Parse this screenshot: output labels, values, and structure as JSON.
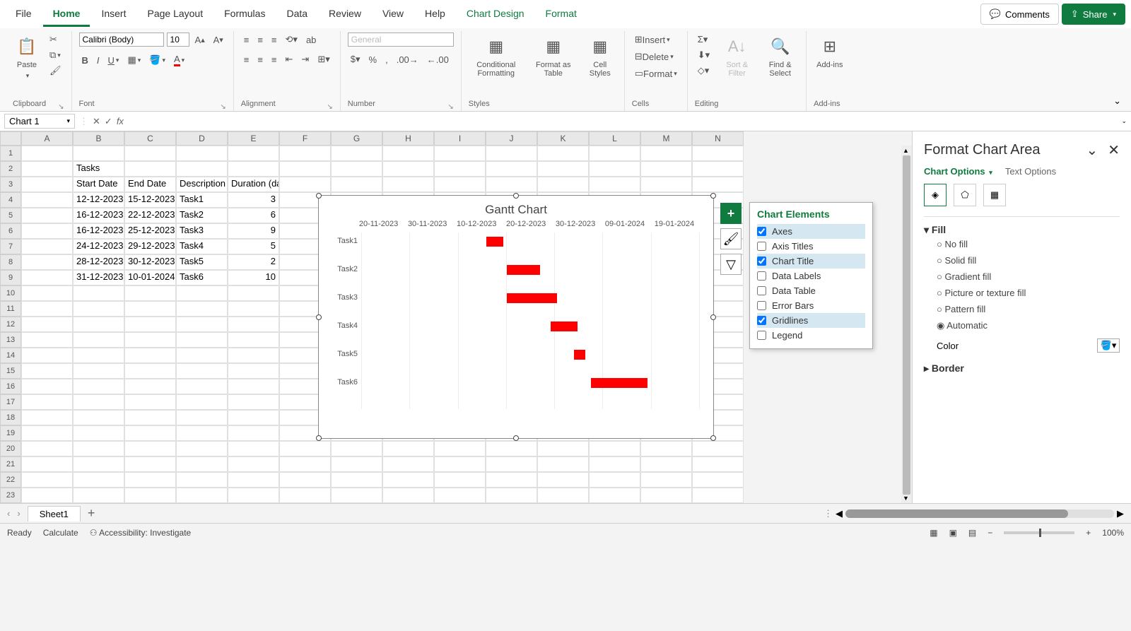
{
  "menu": {
    "file": "File",
    "home": "Home",
    "insert": "Insert",
    "pagelayout": "Page Layout",
    "formulas": "Formulas",
    "data": "Data",
    "review": "Review",
    "view": "View",
    "help": "Help",
    "chartdesign": "Chart Design",
    "format": "Format"
  },
  "toprow": {
    "comments": "Comments",
    "share": "Share"
  },
  "ribbon": {
    "clipboard": {
      "paste": "Paste",
      "label": "Clipboard"
    },
    "font": {
      "name": "Calibri (Body)",
      "size": "10",
      "label": "Font"
    },
    "alignment": {
      "label": "Alignment"
    },
    "number": {
      "format": "General",
      "label": "Number"
    },
    "styles": {
      "cond": "Conditional Formatting",
      "table": "Format as Table",
      "cell": "Cell Styles",
      "label": "Styles"
    },
    "cells": {
      "insert": "Insert",
      "delete": "Delete",
      "format": "Format",
      "label": "Cells"
    },
    "editing": {
      "sort": "Sort & Filter",
      "find": "Find & Select",
      "label": "Editing"
    },
    "addins": {
      "addins": "Add-ins",
      "label": "Add-ins"
    }
  },
  "formula": {
    "name": "Chart 1",
    "value": ""
  },
  "cols": [
    "A",
    "B",
    "C",
    "D",
    "E",
    "F",
    "G",
    "H",
    "I",
    "J",
    "K",
    "L",
    "M",
    "N"
  ],
  "rows_count": 23,
  "table": {
    "b2": "Tasks",
    "headers": {
      "b": "Start Date",
      "c": "End Date",
      "d": "Description",
      "e": "Duration (days)"
    },
    "rows": [
      {
        "start": "12-12-2023",
        "end": "15-12-2023",
        "desc": "Task1",
        "dur": "3"
      },
      {
        "start": "16-12-2023",
        "end": "22-12-2023",
        "desc": "Task2",
        "dur": "6"
      },
      {
        "start": "16-12-2023",
        "end": "25-12-2023",
        "desc": "Task3",
        "dur": "9"
      },
      {
        "start": "24-12-2023",
        "end": "29-12-2023",
        "desc": "Task4",
        "dur": "5"
      },
      {
        "start": "28-12-2023",
        "end": "30-12-2023",
        "desc": "Task5",
        "dur": "2"
      },
      {
        "start": "31-12-2023",
        "end": "10-01-2024",
        "desc": "Task6",
        "dur": "10"
      }
    ]
  },
  "chart": {
    "title": "Gantt Chart",
    "dates": [
      "20-11-2023",
      "30-11-2023",
      "10-12-2023",
      "20-12-2023",
      "30-12-2023",
      "09-01-2024",
      "19-01-2024"
    ],
    "tasks": [
      "Task1",
      "Task2",
      "Task3",
      "Task4",
      "Task5",
      "Task6"
    ]
  },
  "chart_data": {
    "type": "bar",
    "title": "Gantt Chart",
    "orientation": "horizontal",
    "x_axis": {
      "type": "date",
      "ticks": [
        "20-11-2023",
        "30-11-2023",
        "10-12-2023",
        "20-12-2023",
        "30-12-2023",
        "09-01-2024",
        "19-01-2024"
      ],
      "range": [
        "20-11-2023",
        "19-01-2024"
      ]
    },
    "categories": [
      "Task1",
      "Task2",
      "Task3",
      "Task4",
      "Task5",
      "Task6"
    ],
    "series": [
      {
        "name": "Start Date",
        "role": "offset",
        "values": [
          "12-12-2023",
          "16-12-2023",
          "16-12-2023",
          "24-12-2023",
          "28-12-2023",
          "31-12-2023"
        ],
        "fill": "none"
      },
      {
        "name": "Duration (days)",
        "role": "length",
        "values": [
          3,
          6,
          9,
          5,
          2,
          10
        ],
        "color": "#ff0000"
      }
    ],
    "gridlines": {
      "vertical": true,
      "horizontal": false
    },
    "legend": false
  },
  "elements": {
    "title": "Chart Elements",
    "items": [
      {
        "label": "Axes",
        "checked": true
      },
      {
        "label": "Axis Titles",
        "checked": false
      },
      {
        "label": "Chart Title",
        "checked": true
      },
      {
        "label": "Data Labels",
        "checked": false
      },
      {
        "label": "Data Table",
        "checked": false
      },
      {
        "label": "Error Bars",
        "checked": false
      },
      {
        "label": "Gridlines",
        "checked": true
      },
      {
        "label": "Legend",
        "checked": false
      }
    ]
  },
  "pane": {
    "title": "Format Chart Area",
    "tab1": "Chart Options",
    "tab2": "Text Options",
    "fill": "Fill",
    "opts": {
      "nofill": "No fill",
      "solid": "Solid fill",
      "grad": "Gradient fill",
      "pic": "Picture or texture fill",
      "patt": "Pattern fill",
      "auto": "Automatic"
    },
    "color": "Color",
    "border": "Border"
  },
  "tabbar": {
    "sheet": "Sheet1"
  },
  "status": {
    "ready": "Ready",
    "calc": "Calculate",
    "acc": "Accessibility: Investigate",
    "zoom": "100%"
  }
}
